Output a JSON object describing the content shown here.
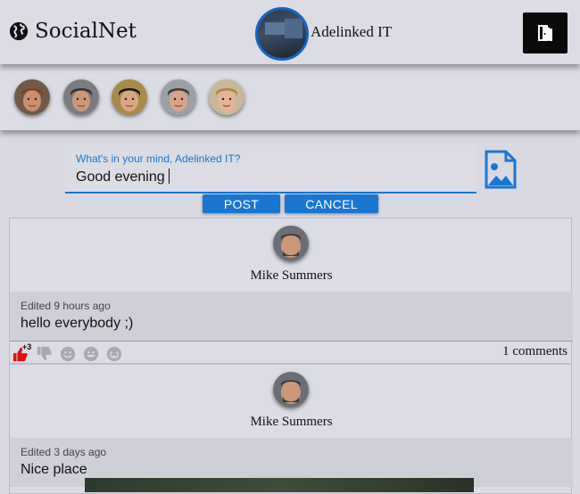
{
  "header": {
    "brand": "SocialNet",
    "user_name": "Adelinked IT"
  },
  "friends": [
    {
      "name": "friend-1",
      "skin": "#c8906e",
      "hair": "#8a3b22",
      "bg": "#6e5a46"
    },
    {
      "name": "friend-2",
      "skin": "#c99879",
      "hair": "#3a2e26",
      "bg": "#7b7b82"
    },
    {
      "name": "friend-3",
      "skin": "#d9a883",
      "hair": "#1a1410",
      "bg": "#a88a4a"
    },
    {
      "name": "friend-4",
      "skin": "#d6a58a",
      "hair": "#4a3426",
      "bg": "#9aa0a6"
    },
    {
      "name": "friend-5",
      "skin": "#e3b592",
      "hair": "#b6803f",
      "bg": "#c8b89a"
    }
  ],
  "composer": {
    "label": "What's in your mind, Adelinked IT?",
    "value": "Good evening",
    "post_label": "POST",
    "cancel_label": "CANCEL"
  },
  "posts": [
    {
      "author": "Mike Summers",
      "edited": "Edited 9 hours ago",
      "text": "hello everybody ;)",
      "like_count": "+3",
      "comments": "1 comments"
    },
    {
      "author": "Mike Summers",
      "edited": "Edited 3 days ago",
      "text": "Nice place"
    }
  ],
  "colors": {
    "accent": "#1976d2",
    "like": "#e01010",
    "reaction_inactive": "#a8a8ae"
  }
}
